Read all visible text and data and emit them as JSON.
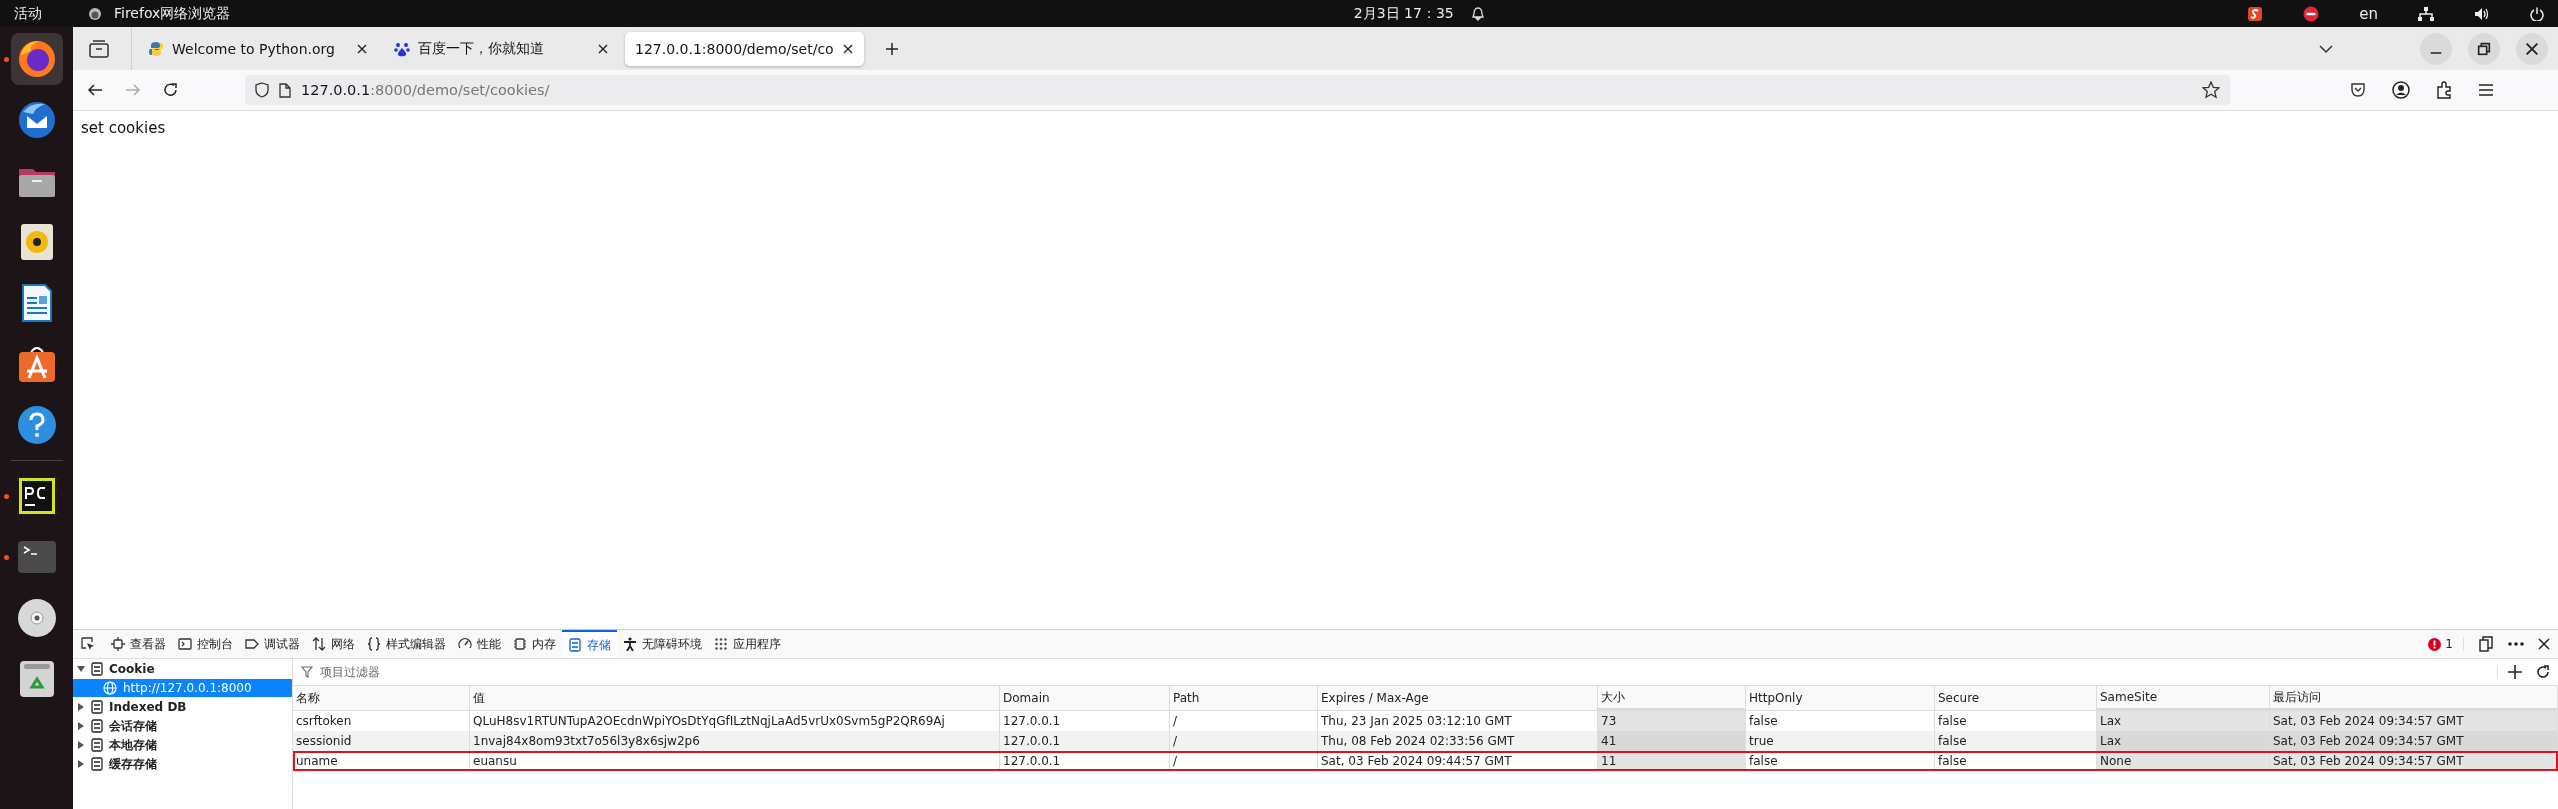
{
  "top_bar": {
    "activities": "活动",
    "app_name": "Firefox网络浏览器",
    "clock": "2月3日  17：35",
    "language": "en"
  },
  "dock": [
    {
      "kind": "browser",
      "selected": true,
      "running": true
    },
    {
      "kind": "mail",
      "selected": false,
      "running": false
    },
    {
      "kind": "files",
      "selected": false,
      "running": false
    },
    {
      "kind": "music",
      "selected": false,
      "running": false
    },
    {
      "kind": "writer",
      "selected": false,
      "running": false
    },
    {
      "kind": "store",
      "selected": false,
      "running": false
    },
    {
      "kind": "help",
      "selected": false,
      "running": false
    },
    {
      "kind": "separator"
    },
    {
      "kind": "ide",
      "selected": false,
      "running": true
    },
    {
      "kind": "terminal",
      "selected": false,
      "running": true
    },
    {
      "kind": "disc",
      "selected": false,
      "running": false
    },
    {
      "kind": "trash",
      "selected": false,
      "running": false
    }
  ],
  "tabs": [
    {
      "kind": "python",
      "title": "Welcome to Python.org",
      "selected": false
    },
    {
      "kind": "paw",
      "title": "百度一下，你就知道",
      "selected": false
    },
    {
      "kind": "none",
      "title": "127.0.0.1:8000/demo/set/co",
      "selected": true
    }
  ],
  "address_bar": {
    "host": "127.0.0.1",
    "rest": ":8000/demo/set/cookies/"
  },
  "page": {
    "text": "set cookies"
  },
  "devtools": {
    "tools": [
      {
        "kind": "inspector",
        "label": "查看器",
        "selected": false
      },
      {
        "kind": "console",
        "label": "控制台",
        "selected": false
      },
      {
        "kind": "debugger",
        "label": "调试器",
        "selected": false
      },
      {
        "kind": "network",
        "label": "网络",
        "selected": false
      },
      {
        "kind": "style",
        "label": "样式编辑器",
        "selected": false
      },
      {
        "kind": "performance",
        "label": "性能",
        "selected": false
      },
      {
        "kind": "memory",
        "label": "内存",
        "selected": false
      },
      {
        "kind": "storage",
        "label": "存储",
        "selected": true
      },
      {
        "kind": "accessibility",
        "label": "无障碍环境",
        "selected": false
      },
      {
        "kind": "application",
        "label": "应用程序",
        "selected": false
      }
    ],
    "error_count": "1",
    "tree": [
      {
        "label": "Cookie",
        "expanded": true,
        "selected": false,
        "children": [
          {
            "label": "http://127.0.0.1:8000",
            "selected": true
          }
        ]
      },
      {
        "label": "Indexed DB",
        "expanded": false,
        "selected": false
      },
      {
        "label": "会话存储",
        "expanded": false,
        "selected": false
      },
      {
        "label": "本地存储",
        "expanded": false,
        "selected": false
      },
      {
        "label": "缓存存储",
        "expanded": false,
        "selected": false
      }
    ],
    "filter": {
      "placeholder": "项目过滤器"
    },
    "table": {
      "columns": [
        {
          "label": "名称",
          "shaded": false
        },
        {
          "label": "值",
          "shaded": false
        },
        {
          "label": "Domain",
          "shaded": false
        },
        {
          "label": "Path",
          "shaded": false
        },
        {
          "label": "Expires / Max-Age",
          "shaded": false
        },
        {
          "label": "大小",
          "shaded": true
        },
        {
          "label": "HttpOnly",
          "shaded": false
        },
        {
          "label": "Secure",
          "shaded": false
        },
        {
          "label": "SameSite",
          "shaded": true
        },
        {
          "label": "最后访问",
          "shaded": true
        }
      ],
      "rows": [
        {
          "highlighted": false,
          "cells": [
            "csrftoken",
            "QLuH8sv1RTUNTupA2OEcdnWpiYOsDtYqGfILztNqjLaAd5vrUx0Svm5gP2QR69Aj",
            "127.0.0.1",
            "/",
            "Thu, 23 Jan 2025 03:12:10 GMT",
            "73",
            "false",
            "false",
            "Lax",
            "Sat, 03 Feb 2024 09:34:57 GMT"
          ]
        },
        {
          "highlighted": false,
          "cells": [
            "sessionid",
            "1nvaj84x8om93txt7o56l3y8x6sjw2p6",
            "127.0.0.1",
            "/",
            "Thu, 08 Feb 2024 02:33:56 GMT",
            "41",
            "true",
            "false",
            "Lax",
            "Sat, 03 Feb 2024 09:34:57 GMT"
          ]
        },
        {
          "highlighted": true,
          "cells": [
            "uname",
            "euansu",
            "127.0.0.1",
            "/",
            "Sat, 03 Feb 2024 09:44:57 GMT",
            "11",
            "false",
            "false",
            "None",
            "Sat, 03 Feb 2024 09:34:57 GMT"
          ]
        }
      ]
    }
  }
}
